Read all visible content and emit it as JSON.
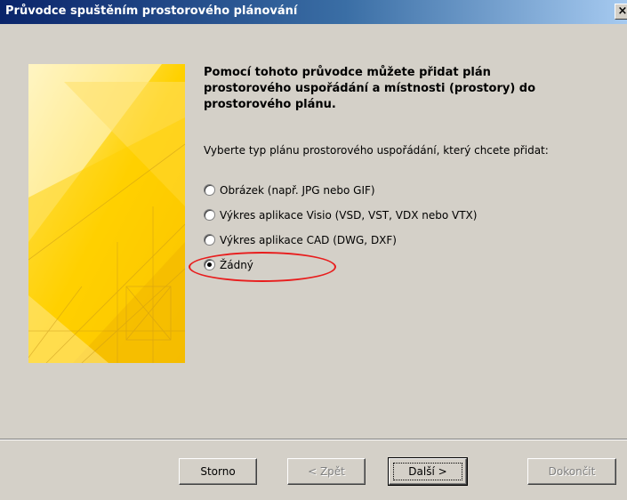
{
  "window": {
    "title": "Průvodce spuštěním prostorového plánování",
    "close_glyph": "×"
  },
  "intro": {
    "heading": "Pomocí tohoto průvodce můžete přidat plán prostorového uspořádání a místnosti (prostory) do prostorového plánu.",
    "prompt": "Vyberte typ plánu prostorového uspořádání, který chcete přidat:"
  },
  "options": [
    {
      "label": "Obrázek (např. JPG nebo GIF)",
      "selected": false
    },
    {
      "label": "Výkres aplikace Visio (VSD, VST, VDX nebo VTX)",
      "selected": false
    },
    {
      "label": "Výkres aplikace CAD (DWG, DXF)",
      "selected": false
    },
    {
      "label": "Žádný",
      "selected": true
    }
  ],
  "buttons": {
    "cancel": "Storno",
    "back": "< Zpět",
    "next": "Další >",
    "finish": "Dokončit"
  },
  "colors": {
    "highlight_ellipse": "#e81d1d",
    "title_bar": "#0a246a",
    "banner_yellow": "#f5c400"
  }
}
